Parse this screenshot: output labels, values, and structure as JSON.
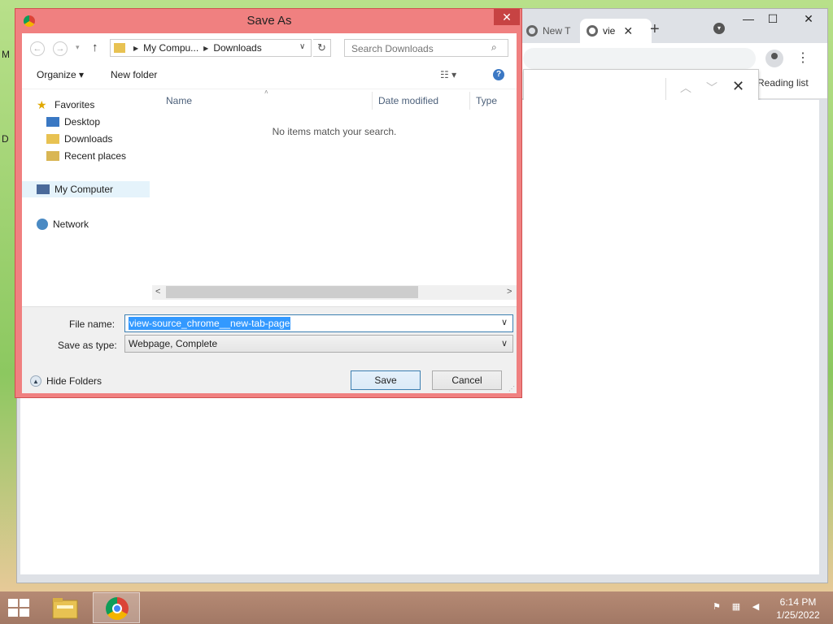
{
  "chrome": {
    "tab1_label": "New T",
    "tab2_label": "vie",
    "tab_close": "✕",
    "new_tab": "+",
    "minimize": "—",
    "maximize": "☐",
    "close": "✕",
    "reading_list": "Reading list",
    "menu": "⋮",
    "find_up": "︿",
    "find_down": "﹀",
    "find_close": "✕"
  },
  "dialog": {
    "title": "Save As",
    "close": "✕",
    "nav": {
      "back": "←",
      "forward": "→",
      "recent": "▾",
      "up": "↑",
      "refresh": "↻",
      "breadcrumb": [
        "My Compu...",
        "Downloads"
      ],
      "crumb_sep": "▶",
      "addr_dropdown": "∨",
      "search_placeholder": "Search Downloads",
      "search_icon": "⌕"
    },
    "toolbar": {
      "organize": "Organize ▾",
      "new_folder": "New folder",
      "view": "☷ ▾",
      "help": "?"
    },
    "navpane": {
      "favorites": "Favorites",
      "desktop": "Desktop",
      "downloads": "Downloads",
      "recent_places": "Recent places",
      "my_computer": "My Computer",
      "network": "Network"
    },
    "columns": {
      "name": "Name",
      "date_modified": "Date modified",
      "type": "Type",
      "sort_arrow": "˄"
    },
    "empty_message": "No items match your search.",
    "scroll_left": "<",
    "scroll_right": ">",
    "file_name_label": "File name:",
    "file_name_value": "view-source_chrome__new-tab-page",
    "save_type_label": "Save as type:",
    "save_type_value": "Webpage, Complete",
    "dropdown_arrow": "∨",
    "hide_folders": "Hide Folders",
    "hide_icon": "▲",
    "save_button": "Save",
    "cancel_button": "Cancel",
    "grip": "⋰"
  },
  "taskbar": {
    "time": "6:14 PM",
    "date": "1/25/2022",
    "tray_flag": "⚑",
    "tray_network": "▦",
    "tray_volume": "◀"
  },
  "desktop": {
    "icon_m": "M",
    "icon_d": "D"
  },
  "colors": {
    "dialog_frame": "#f08080",
    "close_red": "#c74343",
    "selection_blue": "#3399ff",
    "nav_selected": "#e5f3fb"
  }
}
